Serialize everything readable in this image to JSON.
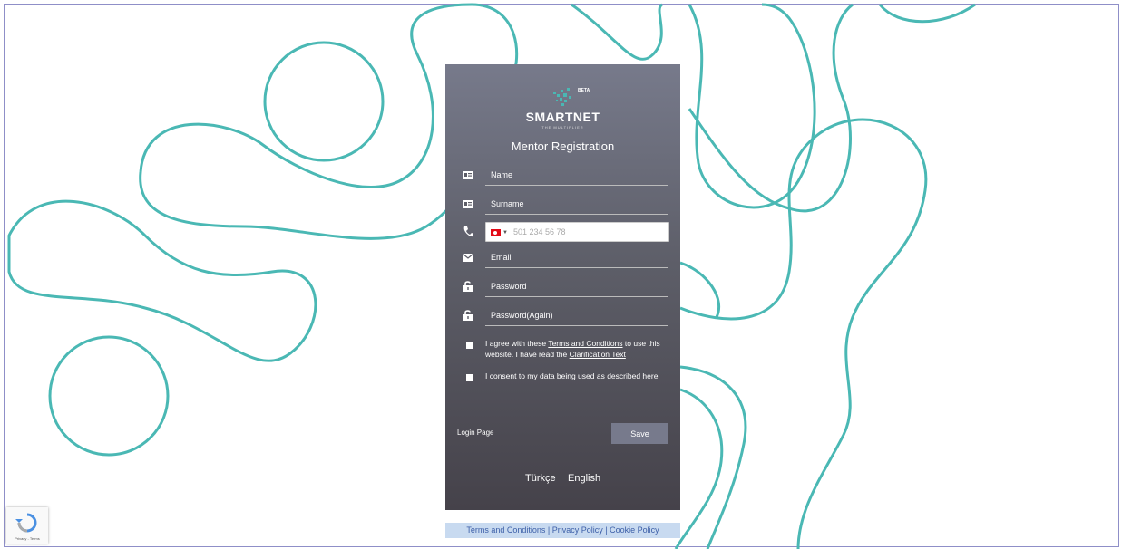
{
  "brand": {
    "name": "SMARTNET",
    "tagline": "THE MULTIPLIER",
    "badge": "BETA"
  },
  "title": "Mentor Registration",
  "fields": {
    "name": "Name",
    "surname": "Surname",
    "phone_placeholder": "501 234 56 78",
    "email": "Email",
    "password": "Password",
    "password_again": "Password(Again)"
  },
  "consent1": {
    "prefix": "I agree with these ",
    "terms_link": "Terms and Conditions",
    "middle": " to use this website. I have read the ",
    "clar_link": "Clarification Text",
    "suffix": " ."
  },
  "consent2": {
    "text": "I consent to my data being used as described ",
    "link": "here."
  },
  "login_link": "Login Page",
  "save_button": "Save",
  "languages": [
    "Türkçe",
    "English"
  ],
  "footer": {
    "terms": "Terms and Conditions",
    "privacy": "Privacy Policy",
    "cookie": "Cookie Policy",
    "sep": "|"
  },
  "captcha": {
    "label": "Privacy - Terms"
  },
  "colors": {
    "swirl": "#4ab8b4",
    "card_top": "#777a8b",
    "card_bottom": "#45424a",
    "footer_bg": "#c8daf0"
  }
}
